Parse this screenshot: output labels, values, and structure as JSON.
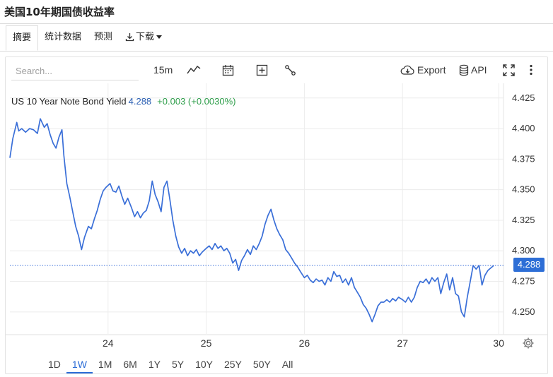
{
  "page": {
    "title": "美国10年期国债收益率"
  },
  "tabs": [
    {
      "label": "摘要",
      "active": true
    },
    {
      "label": "统计数据",
      "active": false
    },
    {
      "label": "预测",
      "active": false
    },
    {
      "label": "下载",
      "active": false
    }
  ],
  "toolbar": {
    "search_placeholder": "Search...",
    "interval": "15m",
    "export_label": "Export",
    "api_label": "API",
    "icons": [
      "line-chart-icon",
      "calendar-icon",
      "add-indicator-icon",
      "draw-tools-icon",
      "cloud-download-icon",
      "database-icon",
      "fullscreen-icon",
      "more-vertical-icon"
    ]
  },
  "legend": {
    "name": "US 10 Year Note Bond Yield",
    "last": "4.288",
    "change": "+0.003 (+0.0030%)"
  },
  "price_tag": "4.288",
  "ranges": [
    {
      "label": "1D",
      "active": false
    },
    {
      "label": "1W",
      "active": true
    },
    {
      "label": "1M",
      "active": false
    },
    {
      "label": "6M",
      "active": false
    },
    {
      "label": "1Y",
      "active": false
    },
    {
      "label": "5Y",
      "active": false
    },
    {
      "label": "10Y",
      "active": false
    },
    {
      "label": "25Y",
      "active": false
    },
    {
      "label": "50Y",
      "active": false
    },
    {
      "label": "All",
      "active": false
    }
  ],
  "colors": {
    "line": "#3a6fd8",
    "accent": "#2b6cd6",
    "positive": "#2e9e4a",
    "tag": "#2d6ed6"
  },
  "chart_data": {
    "type": "line",
    "title": "",
    "xlabel": "",
    "ylabel": "",
    "x_ticks": [
      "24",
      "25",
      "26",
      "27",
      "30"
    ],
    "y_ticks": [
      "4.425",
      "4.400",
      "4.375",
      "4.350",
      "4.325",
      "4.300",
      "4.275",
      "4.250"
    ],
    "ylim": [
      4.232,
      4.437
    ],
    "xlim": [
      0,
      5.0
    ],
    "grid": true,
    "last_value": 4.288,
    "series": [
      {
        "values": [
          [
            0.0,
            4.376
          ],
          [
            0.03,
            4.392
          ],
          [
            0.07,
            4.405
          ],
          [
            0.09,
            4.398
          ],
          [
            0.12,
            4.4
          ],
          [
            0.16,
            4.397
          ],
          [
            0.2,
            4.4
          ],
          [
            0.24,
            4.399
          ],
          [
            0.28,
            4.396
          ],
          [
            0.31,
            4.408
          ],
          [
            0.35,
            4.401
          ],
          [
            0.38,
            4.404
          ],
          [
            0.41,
            4.395
          ],
          [
            0.44,
            4.388
          ],
          [
            0.47,
            4.384
          ],
          [
            0.5,
            4.393
          ],
          [
            0.53,
            4.399
          ],
          [
            0.55,
            4.378
          ],
          [
            0.58,
            4.355
          ],
          [
            0.61,
            4.344
          ],
          [
            0.64,
            4.332
          ],
          [
            0.67,
            4.32
          ],
          [
            0.7,
            4.312
          ],
          [
            0.73,
            4.301
          ],
          [
            0.76,
            4.311
          ],
          [
            0.8,
            4.32
          ],
          [
            0.83,
            4.318
          ],
          [
            0.86,
            4.326
          ],
          [
            0.89,
            4.333
          ],
          [
            0.92,
            4.342
          ],
          [
            0.95,
            4.349
          ],
          [
            0.98,
            4.352
          ],
          [
            1.02,
            4.355
          ],
          [
            1.05,
            4.349
          ],
          [
            1.08,
            4.348
          ],
          [
            1.11,
            4.353
          ],
          [
            1.14,
            4.345
          ],
          [
            1.17,
            4.338
          ],
          [
            1.2,
            4.343
          ],
          [
            1.24,
            4.335
          ],
          [
            1.27,
            4.328
          ],
          [
            1.3,
            4.332
          ],
          [
            1.33,
            4.327
          ],
          [
            1.36,
            4.331
          ],
          [
            1.39,
            4.333
          ],
          [
            1.42,
            4.341
          ],
          [
            1.45,
            4.357
          ],
          [
            1.48,
            4.346
          ],
          [
            1.51,
            4.34
          ],
          [
            1.54,
            4.332
          ],
          [
            1.57,
            4.352
          ],
          [
            1.6,
            4.357
          ],
          [
            1.63,
            4.342
          ],
          [
            1.66,
            4.325
          ],
          [
            1.69,
            4.312
          ],
          [
            1.72,
            4.303
          ],
          [
            1.75,
            4.298
          ],
          [
            1.78,
            4.302
          ],
          [
            1.81,
            4.296
          ],
          [
            1.84,
            4.3
          ],
          [
            1.87,
            4.298
          ],
          [
            1.9,
            4.301
          ],
          [
            1.93,
            4.296
          ],
          [
            1.96,
            4.299
          ],
          [
            2.0,
            4.302
          ],
          [
            2.03,
            4.304
          ],
          [
            2.06,
            4.301
          ],
          [
            2.09,
            4.306
          ],
          [
            2.12,
            4.302
          ],
          [
            2.15,
            4.304
          ],
          [
            2.18,
            4.3
          ],
          [
            2.21,
            4.302
          ],
          [
            2.24,
            4.298
          ],
          [
            2.27,
            4.29
          ],
          [
            2.3,
            4.293
          ],
          [
            2.33,
            4.284
          ],
          [
            2.36,
            4.292
          ],
          [
            2.39,
            4.296
          ],
          [
            2.42,
            4.301
          ],
          [
            2.45,
            4.297
          ],
          [
            2.48,
            4.304
          ],
          [
            2.51,
            4.301
          ],
          [
            2.54,
            4.306
          ],
          [
            2.57,
            4.312
          ],
          [
            2.6,
            4.322
          ],
          [
            2.63,
            4.329
          ],
          [
            2.66,
            4.334
          ],
          [
            2.69,
            4.325
          ],
          [
            2.72,
            4.318
          ],
          [
            2.75,
            4.313
          ],
          [
            2.78,
            4.309
          ],
          [
            2.81,
            4.301
          ],
          [
            2.84,
            4.298
          ],
          [
            2.87,
            4.294
          ],
          [
            2.9,
            4.29
          ],
          [
            2.93,
            4.287
          ],
          [
            2.96,
            4.283
          ],
          [
            3.0,
            4.278
          ],
          [
            3.03,
            4.28
          ],
          [
            3.06,
            4.276
          ],
          [
            3.09,
            4.274
          ],
          [
            3.12,
            4.277
          ],
          [
            3.15,
            4.275
          ],
          [
            3.18,
            4.276
          ],
          [
            3.21,
            4.272
          ],
          [
            3.24,
            4.278
          ],
          [
            3.27,
            4.275
          ],
          [
            3.3,
            4.283
          ],
          [
            3.33,
            4.279
          ],
          [
            3.36,
            4.28
          ],
          [
            3.39,
            4.274
          ],
          [
            3.42,
            4.277
          ],
          [
            3.45,
            4.272
          ],
          [
            3.48,
            4.278
          ],
          [
            3.51,
            4.27
          ],
          [
            3.54,
            4.266
          ],
          [
            3.57,
            4.262
          ],
          [
            3.6,
            4.256
          ],
          [
            3.63,
            4.253
          ],
          [
            3.66,
            4.248
          ],
          [
            3.69,
            4.242
          ],
          [
            3.72,
            4.248
          ],
          [
            3.75,
            4.255
          ],
          [
            3.78,
            4.258
          ],
          [
            3.81,
            4.258
          ],
          [
            3.84,
            4.26
          ],
          [
            3.87,
            4.258
          ],
          [
            3.9,
            4.261
          ],
          [
            3.93,
            4.259
          ],
          [
            3.96,
            4.262
          ],
          [
            4.0,
            4.26
          ],
          [
            4.03,
            4.258
          ],
          [
            4.06,
            4.262
          ],
          [
            4.09,
            4.258
          ],
          [
            4.12,
            4.262
          ],
          [
            4.15,
            4.27
          ],
          [
            4.18,
            4.275
          ],
          [
            4.21,
            4.274
          ],
          [
            4.24,
            4.277
          ],
          [
            4.27,
            4.273
          ],
          [
            4.3,
            4.278
          ],
          [
            4.33,
            4.275
          ],
          [
            4.36,
            4.278
          ],
          [
            4.39,
            4.265
          ],
          [
            4.42,
            4.274
          ],
          [
            4.45,
            4.281
          ],
          [
            4.48,
            4.268
          ],
          [
            4.51,
            4.278
          ],
          [
            4.54,
            4.265
          ],
          [
            4.57,
            4.263
          ],
          [
            4.6,
            4.25
          ],
          [
            4.63,
            4.246
          ],
          [
            4.66,
            4.262
          ],
          [
            4.69,
            4.275
          ],
          [
            4.72,
            4.288
          ],
          [
            4.75,
            4.285
          ],
          [
            4.78,
            4.288
          ],
          [
            4.81,
            4.272
          ],
          [
            4.84,
            4.28
          ],
          [
            4.87,
            4.284
          ],
          [
            4.9,
            4.286
          ],
          [
            4.93,
            4.288
          ]
        ]
      }
    ]
  }
}
